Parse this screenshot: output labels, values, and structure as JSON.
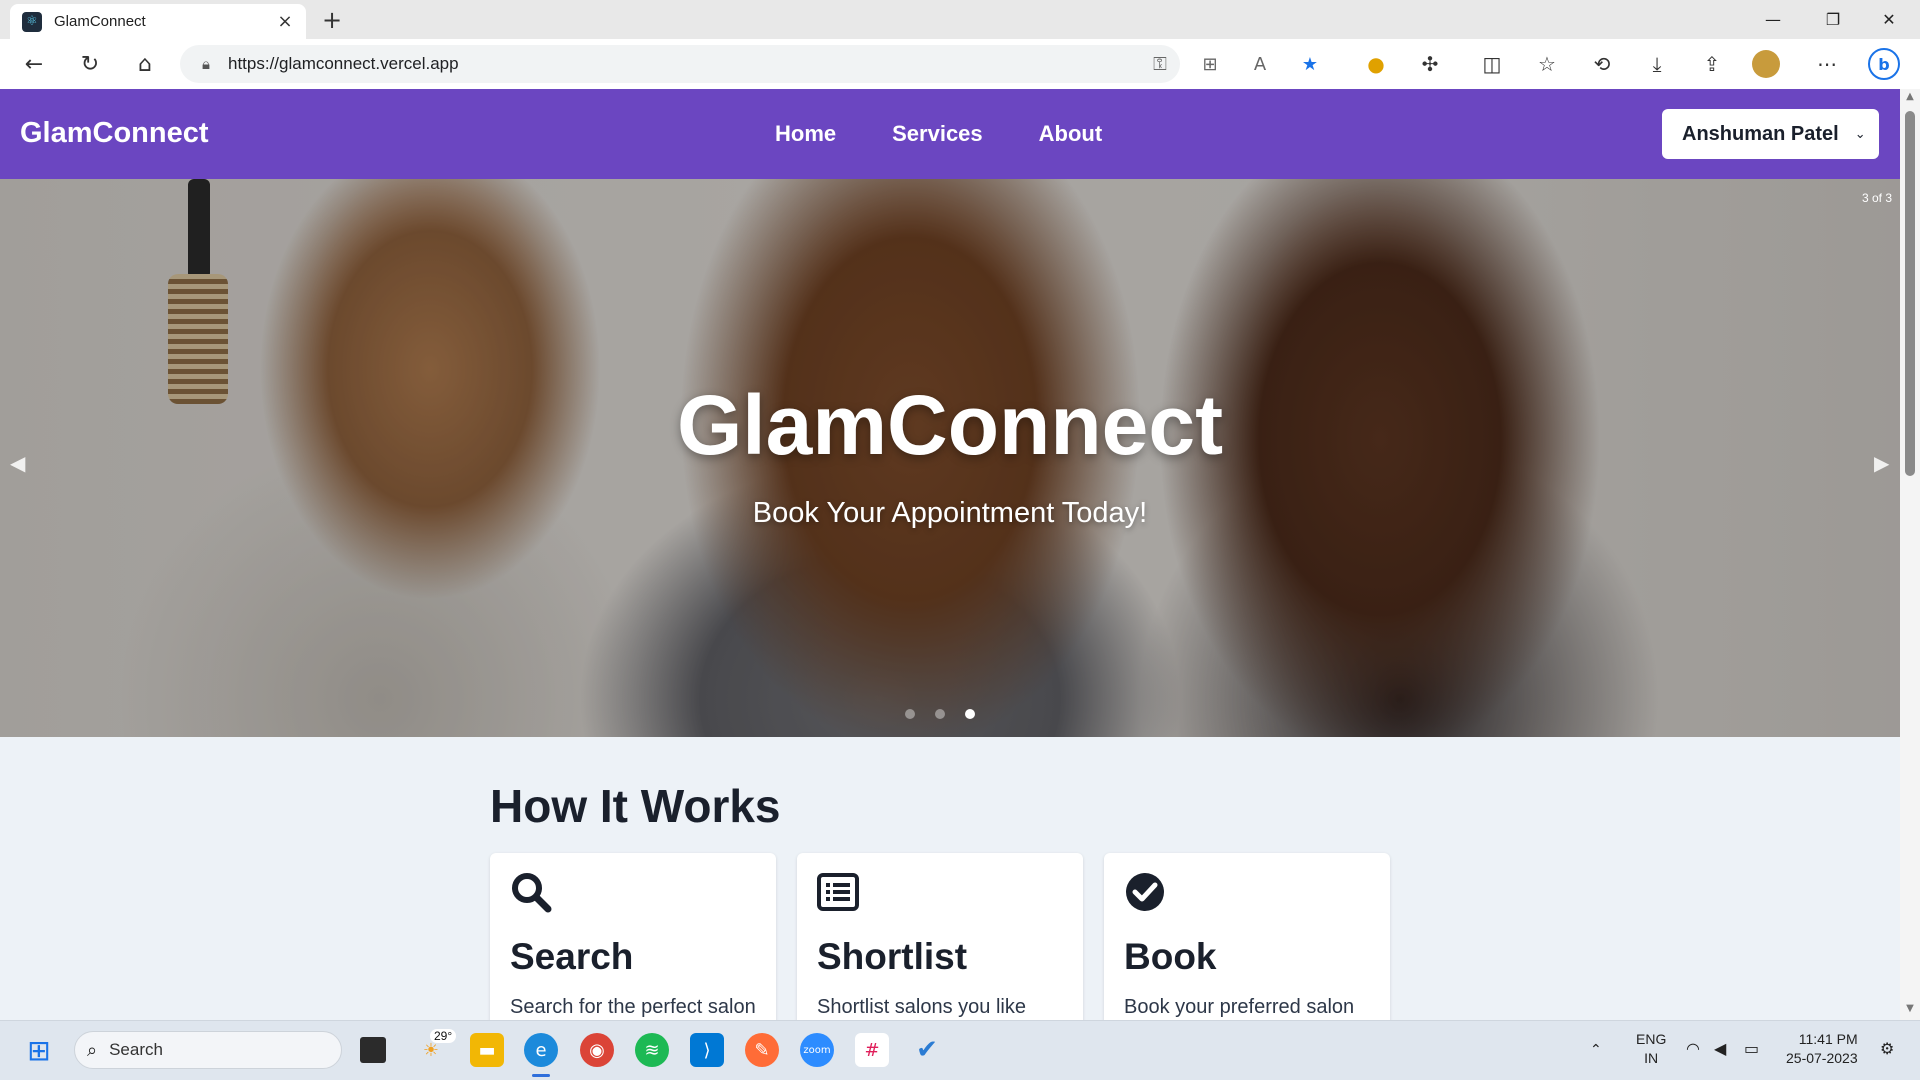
{
  "browser": {
    "tab_title": "GlamConnect",
    "url": "https://glamconnect.vercel.app"
  },
  "site": {
    "brand": "GlamConnect",
    "nav": [
      {
        "label": "Home"
      },
      {
        "label": "Services"
      },
      {
        "label": "About"
      }
    ],
    "user_name": "Anshuman Patel"
  },
  "hero": {
    "title": "GlamConnect",
    "subtitle": "Book Your Appointment Today!",
    "slide_counter": "3 of 3",
    "slide_count": 3,
    "active_slide": 3
  },
  "how_it_works": {
    "title": "How It Works",
    "cards": [
      {
        "icon": "search-icon",
        "title": "Search",
        "desc": "Search for the perfect salon"
      },
      {
        "icon": "list-icon",
        "title": "Shortlist",
        "desc": "Shortlist salons you like"
      },
      {
        "icon": "check-circle-icon",
        "title": "Book",
        "desc": "Book your preferred salon"
      }
    ]
  },
  "taskbar": {
    "search_placeholder": "Search",
    "weather_temp": "29°",
    "lang_line1": "ENG",
    "lang_line2": "IN",
    "time": "11:41 PM",
    "date": "25-07-2023"
  },
  "colors": {
    "brand_purple": "#6b46c1",
    "page_bg": "#edf2f7",
    "text_dark": "#1a202c"
  }
}
